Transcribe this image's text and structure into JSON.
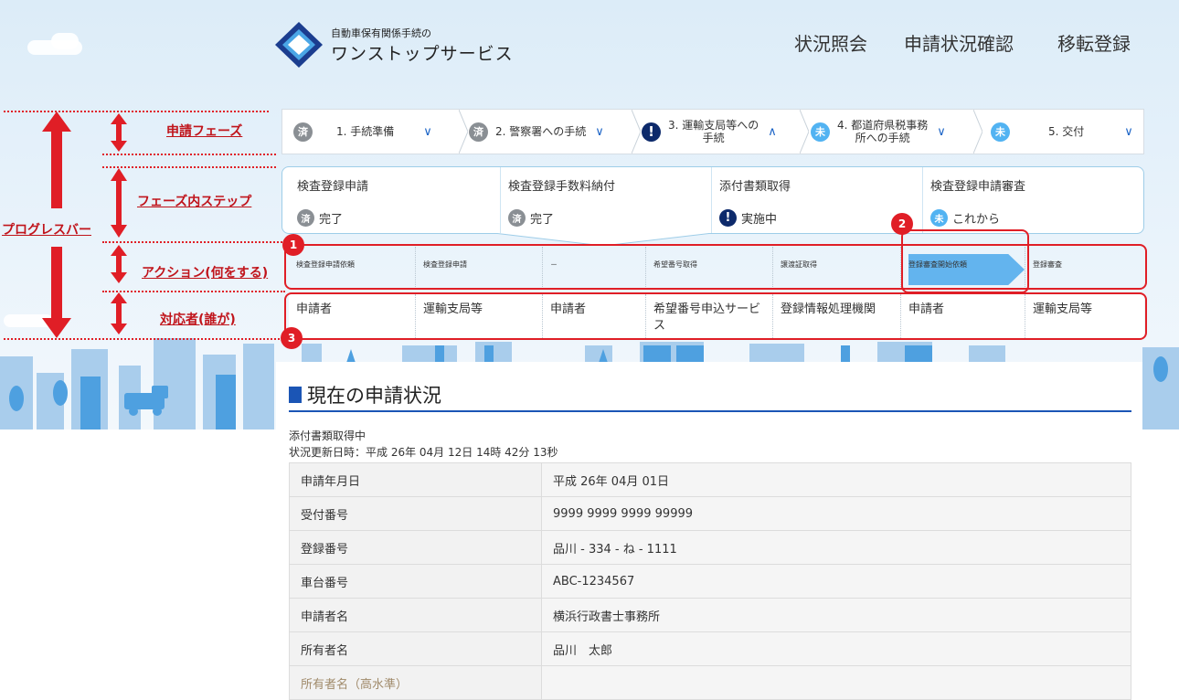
{
  "header": {
    "logo_subtitle": "自動車保有関係手続の",
    "logo_title": "ワンストップサービス",
    "nav": [
      "状況照会",
      "申請状況確認",
      "移転登録"
    ]
  },
  "phases": [
    {
      "icon": "済",
      "label": "1. 手続準備",
      "chevron": "∨",
      "state": "done"
    },
    {
      "icon": "済",
      "label": "2. 警察署への手続",
      "chevron": "∨",
      "state": "done"
    },
    {
      "icon": "!",
      "label1": "3. 運輸支局等への",
      "label2": "手続",
      "chevron": "∧",
      "state": "active"
    },
    {
      "icon": "未",
      "label1": "4. 都道府県税事務",
      "label2": "所への手続",
      "chevron": "∨",
      "state": "todo"
    },
    {
      "icon": "未",
      "label": "5. 交付",
      "chevron": "∨",
      "state": "todo"
    }
  ],
  "steps": [
    {
      "title": "検査登録申請",
      "icon": "済",
      "status": "完了",
      "state": "done"
    },
    {
      "title": "検査登録手数料納付",
      "icon": "済",
      "status": "完了",
      "state": "done"
    },
    {
      "title": "添付書類取得",
      "icon": "!",
      "status": "実施中",
      "state": "active"
    },
    {
      "title": "検査登録申請審査",
      "icon": "未",
      "status": "これから",
      "state": "todo"
    }
  ],
  "actions": [
    "検査登録申請依頼",
    "検査登録申請",
    "－",
    "希望番号取得",
    "譲渡証取得",
    "登録審査開始依頼",
    "登録審査"
  ],
  "responsible": [
    "申請者",
    "運輸支局等",
    "申請者",
    "希望番号申込サービス",
    "登録情報処理機関",
    "申請者",
    "運輸支局等"
  ],
  "annotations": {
    "phase_label": "申請フェーズ",
    "step_label": "フェーズ内ステップ",
    "progress_label": "プログレスバー",
    "action_label": "アクション(何をする)",
    "who_label": "対応者(誰が)",
    "badges": [
      "1",
      "2",
      "3"
    ]
  },
  "status": {
    "section_title": "現在の申請状況",
    "status_text": "添付書類取得中",
    "updated": "状況更新日時：平成 26年 04月 12日 14時 42分 13秒",
    "rows": [
      {
        "label": "申請年月日",
        "value": "平成 26年 04月 01日"
      },
      {
        "label": "受付番号",
        "value": "9999 9999 9999 99999"
      },
      {
        "label": "登録番号",
        "value": "品川 - 334 - ね - 1111"
      },
      {
        "label": "車台番号",
        "value": "ABC-1234567"
      },
      {
        "label": "申請者名",
        "value": "横浜行政書士事務所"
      },
      {
        "label": "所有者名",
        "value": "品川　太郎"
      },
      {
        "label": "所有者名（高水準）",
        "value": ""
      }
    ]
  },
  "colors": {
    "annotation_red": "#e01e26",
    "done_gray": "#8a8f94",
    "active_navy": "#0d2a6b",
    "todo_blue": "#52b3f2",
    "accent_blue": "#1b55b5"
  }
}
